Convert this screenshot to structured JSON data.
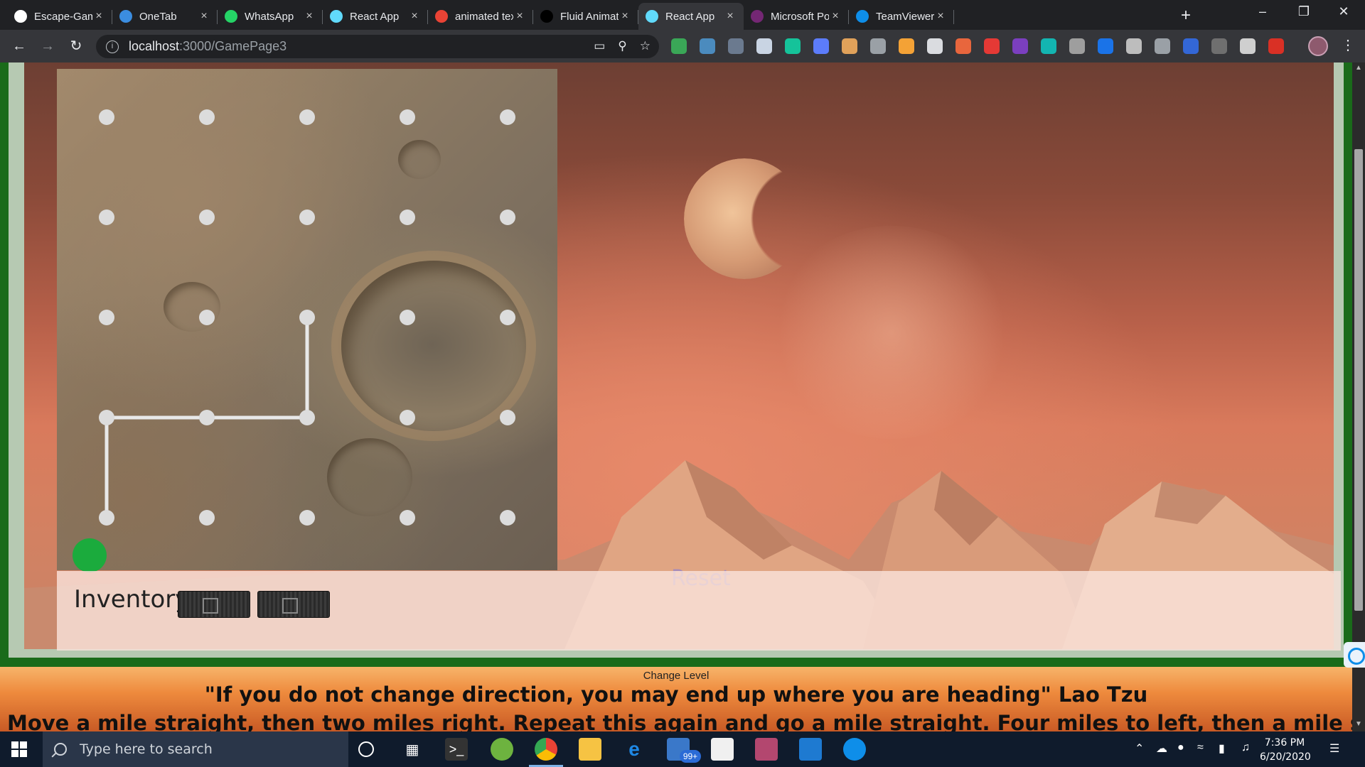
{
  "browser": {
    "tabs": [
      {
        "title": "Escape-Game/I",
        "icon": "github-icon",
        "color": "#ffffff",
        "active": false
      },
      {
        "title": "OneTab",
        "icon": "onetab-icon",
        "color": "#3b8de0",
        "active": false
      },
      {
        "title": "WhatsApp",
        "icon": "whatsapp-icon",
        "color": "#25d366",
        "active": false
      },
      {
        "title": "React App",
        "icon": "react-icon",
        "color": "#61dafb",
        "active": false
      },
      {
        "title": "animated text c",
        "icon": "google-icon",
        "color": "#ea4335",
        "active": false
      },
      {
        "title": "Fluid Animated",
        "icon": "dev-icon",
        "color": "#000000",
        "active": false
      },
      {
        "title": "React App",
        "icon": "react-icon",
        "color": "#61dafb",
        "active": true
      },
      {
        "title": "Microsoft Powe",
        "icon": "powerapps-icon",
        "color": "#742774",
        "active": false
      },
      {
        "title": "TeamViewer – T",
        "icon": "teamviewer-icon",
        "color": "#0e8ee9",
        "active": false
      }
    ],
    "url": {
      "host": "localhost",
      "path": ":3000/GamePage3"
    }
  },
  "game": {
    "grid": {
      "rows": 5,
      "cols": 5
    },
    "pattern_path": [
      [
        2,
        2
      ],
      [
        3,
        2
      ],
      [
        3,
        1
      ],
      [
        3,
        0
      ],
      [
        4,
        0
      ]
    ],
    "reset_label": "Reset",
    "inventory_label": "Inventory",
    "inventory_items": [
      "gpu-card-icon",
      "gpu-card-icon"
    ],
    "indicator_color": "#1bab3d"
  },
  "footer": {
    "change_level": "Change Level",
    "quote": "\"If you do not change direction, you may end up where you are heading\" Lao Tzu",
    "clue": "Move a mile straight, then two miles right. Repeat this again and go a mile straight. Four miles to left, then a mile straight once"
  },
  "taskbar": {
    "search_placeholder": "Type here to search",
    "mail_badge": "99+",
    "time": "7:36 PM",
    "date": "6/20/2020"
  }
}
